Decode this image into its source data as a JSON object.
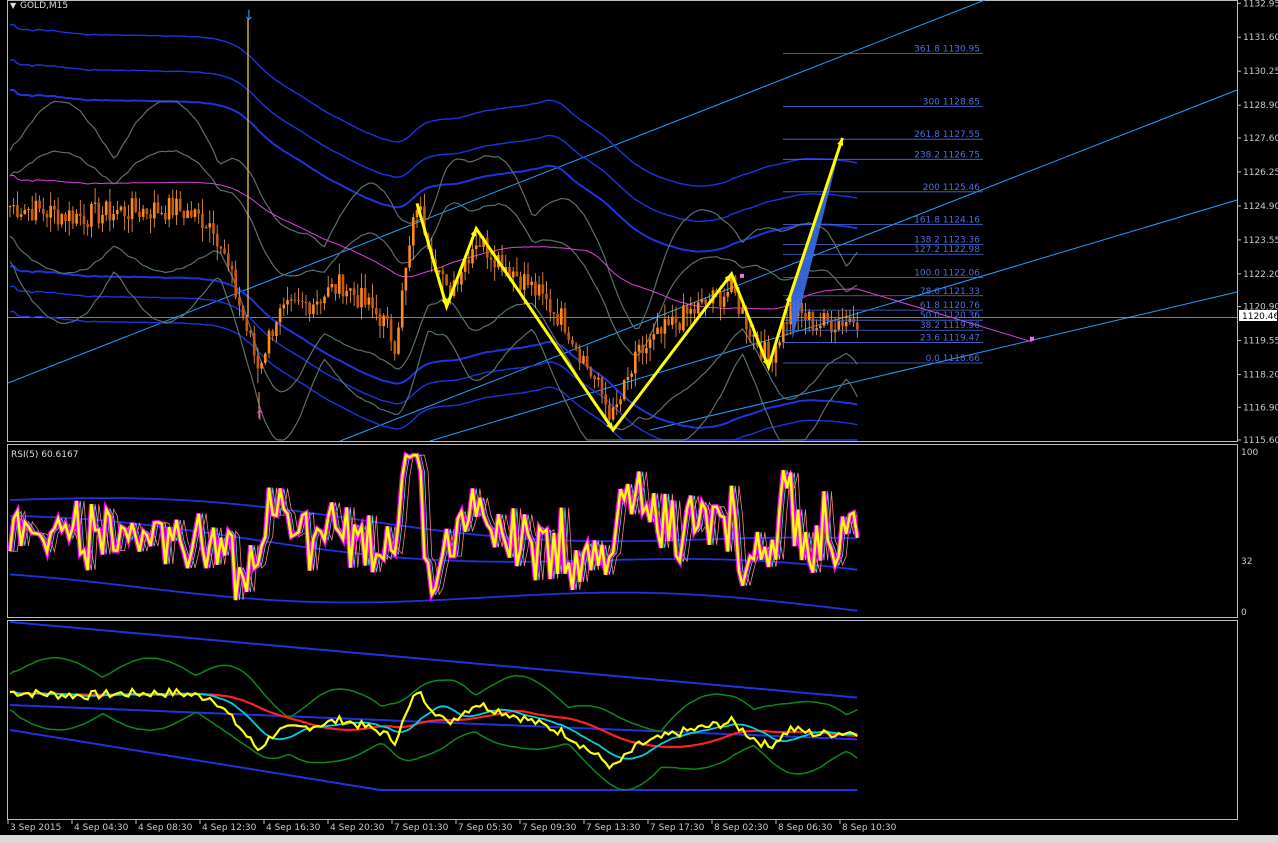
{
  "header": {
    "symbol_label": "GOLD,M15",
    "current_price": "1120.46"
  },
  "colors": {
    "background": "#000000",
    "frame": "#bdbdbd",
    "bull_candle": "#ff8c1a",
    "bear_candle": "#ff8c1a",
    "zigzag": "#ffff00",
    "channel": "#1fa0ff",
    "band": "#1f33e0",
    "bollinger": "#5a706a",
    "ma": "#e040e0",
    "fib": "#4a6ee0",
    "pattern_fill": "#3a6ee8",
    "rsi_main": "#ffff00",
    "rsi_shadow": "#ff00ff",
    "osc_fast": "#ffff00",
    "osc_mid": "#00d0e0",
    "osc_slow": "#ff2020",
    "osc_env": "#0a8a1a"
  },
  "chart_data": [
    {
      "type": "candlestick",
      "title": "GOLD,M15",
      "ylim": [
        1115.6,
        1133.0
      ],
      "y_ticks": [
        "1132.95",
        "1131.60",
        "1130.25",
        "1128.90",
        "1127.60",
        "1126.25",
        "1124.90",
        "1123.55",
        "1122.20",
        "1120.90",
        "1119.55",
        "1118.20",
        "1116.90",
        "1115.60"
      ],
      "current_price": 1120.46,
      "x_ticks": [
        "3 Sep 2015",
        "4 Sep 04:30",
        "4 Sep 08:30",
        "4 Sep 12:30",
        "4 Sep 16:30",
        "4 Sep 20:30",
        "7 Sep 01:30",
        "7 Sep 05:30",
        "7 Sep 09:30",
        "7 Sep 13:30",
        "7 Sep 17:30",
        "8 Sep 02:30",
        "8 Sep 06:30",
        "8 Sep 10:30"
      ],
      "fibonacci_levels": [
        {
          "label": "361.8",
          "price": "1130.95"
        },
        {
          "label": "300",
          "price": "1128.85"
        },
        {
          "label": "261.8",
          "price": "1127.55"
        },
        {
          "label": "238.2",
          "price": "1126.75"
        },
        {
          "label": "200",
          "price": "1125.46"
        },
        {
          "label": "161.8",
          "price": "1124.16"
        },
        {
          "label": "138.2",
          "price": "1123.36"
        },
        {
          "label": "127.2",
          "price": "1122.98"
        },
        {
          "label": "100.0",
          "price": "1122.06"
        },
        {
          "label": "78.6",
          "price": "1121.33"
        },
        {
          "label": "61.8",
          "price": "1120.76"
        },
        {
          "label": "50.0",
          "price": "1120.36"
        },
        {
          "label": "38.2",
          "price": "1119.96"
        },
        {
          "label": "23.6",
          "price": "1119.47"
        },
        {
          "label": "0.0",
          "price": "1118.66"
        }
      ],
      "zigzag": [
        {
          "bar": 110,
          "price": 1125.0
        },
        {
          "bar": 118,
          "price": 1120.9
        },
        {
          "bar": 126,
          "price": 1124.0
        },
        {
          "bar": 163,
          "price": 1116.0
        },
        {
          "bar": 195,
          "price": 1122.2
        },
        {
          "bar": 205,
          "price": 1118.5
        },
        {
          "bar": 211,
          "price": 1121.4
        },
        {
          "bar": 225,
          "price": 1127.6
        }
      ]
    },
    {
      "type": "line",
      "title": "RSI(5) 60.6167",
      "ylim": [
        0,
        100
      ],
      "y_ticks": [
        "100",
        "32",
        "0"
      ]
    },
    {
      "type": "line",
      "title": "",
      "ylim": [
        0,
        1
      ]
    }
  ]
}
